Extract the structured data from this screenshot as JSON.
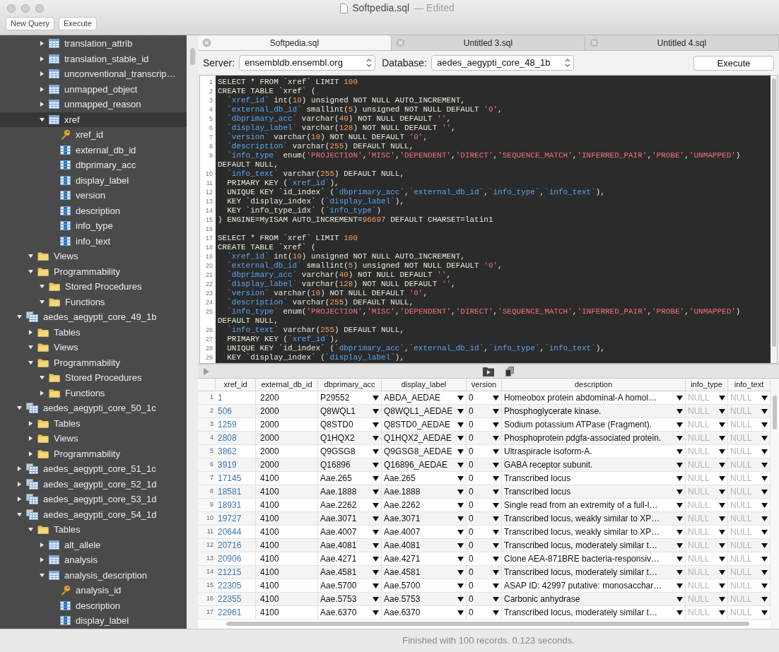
{
  "window": {
    "title": "Softpedia.sql",
    "status": "— Edited"
  },
  "toolbar": {
    "buttons": [
      "New Query",
      "Execute"
    ]
  },
  "sidebar": {
    "partial_tables": [
      {
        "label": "translation_attrib",
        "kind": "table",
        "expanded": false,
        "selected": false
      },
      {
        "label": "translation_stable_id",
        "kind": "table",
        "expanded": false,
        "selected": false
      },
      {
        "label": "unconventional_transcrip…",
        "kind": "table",
        "expanded": false,
        "selected": false
      },
      {
        "label": "unmapped_object",
        "kind": "table",
        "expanded": false,
        "selected": false
      },
      {
        "label": "unmapped_reason",
        "kind": "table",
        "expanded": false,
        "selected": false
      },
      {
        "label": "xref",
        "kind": "table",
        "expanded": true,
        "selected": true,
        "children": [
          {
            "label": "xref_id",
            "kind": "key",
            "selected": false
          },
          {
            "label": "external_db_id",
            "kind": "column",
            "selected": false
          },
          {
            "label": "dbprimary_acc",
            "kind": "column",
            "selected": false
          },
          {
            "label": "display_label",
            "kind": "column",
            "selected": false
          },
          {
            "label": "version",
            "kind": "column",
            "selected": false
          },
          {
            "label": "description",
            "kind": "column",
            "selected": false
          },
          {
            "label": "info_type",
            "kind": "column",
            "selected": false
          },
          {
            "label": "info_text",
            "kind": "column",
            "selected": false
          }
        ]
      }
    ],
    "partial_folders": [
      {
        "label": "Views",
        "kind": "folder",
        "expanded": true,
        "selected": false
      },
      {
        "label": "Programmability",
        "kind": "folder",
        "expanded": true,
        "selected": false,
        "children": [
          {
            "label": "Stored Procedures",
            "kind": "folder",
            "expanded": true,
            "selected": false
          },
          {
            "label": "Functions",
            "kind": "folder",
            "expanded": true,
            "selected": false
          }
        ]
      }
    ],
    "databases": [
      {
        "label": "aedes_aegypti_core_49_1b",
        "kind": "database",
        "expanded": true,
        "selected": false,
        "children": [
          {
            "label": "Tables",
            "kind": "folder",
            "expanded": false,
            "selected": false
          },
          {
            "label": "Views",
            "kind": "folder",
            "expanded": true,
            "selected": false
          },
          {
            "label": "Programmability",
            "kind": "folder",
            "expanded": true,
            "selected": false,
            "children": [
              {
                "label": "Stored Procedures",
                "kind": "folder",
                "expanded": true,
                "selected": false
              },
              {
                "label": "Functions",
                "kind": "folder",
                "expanded": false,
                "selected": false
              }
            ]
          }
        ]
      },
      {
        "label": "aedes_aegypti_core_50_1c",
        "kind": "database",
        "expanded": true,
        "selected": false,
        "children": [
          {
            "label": "Tables",
            "kind": "folder",
            "expanded": false,
            "selected": false
          },
          {
            "label": "Views",
            "kind": "folder",
            "expanded": false,
            "selected": false
          },
          {
            "label": "Programmability",
            "kind": "folder",
            "expanded": false,
            "selected": false
          }
        ]
      },
      {
        "label": "aedes_aegypti_core_51_1c",
        "kind": "database",
        "expanded": false,
        "selected": false
      },
      {
        "label": "aedes_aegypti_core_52_1d",
        "kind": "database",
        "expanded": false,
        "selected": false
      },
      {
        "label": "aedes_aegypti_core_53_1d",
        "kind": "database",
        "expanded": false,
        "selected": false
      },
      {
        "label": "aedes_aegypti_core_54_1d",
        "kind": "database",
        "expanded": true,
        "selected": false,
        "children": [
          {
            "label": "Tables",
            "kind": "folder",
            "expanded": true,
            "selected": false,
            "children": [
              {
                "label": "alt_allele",
                "kind": "table",
                "expanded": false,
                "selected": false
              },
              {
                "label": "analysis",
                "kind": "table",
                "expanded": false,
                "selected": false
              },
              {
                "label": "analysis_description",
                "kind": "table",
                "expanded": true,
                "selected": false,
                "children": [
                  {
                    "label": "analysis_id",
                    "kind": "key",
                    "selected": false
                  },
                  {
                    "label": "description",
                    "kind": "column",
                    "selected": false
                  },
                  {
                    "label": "display_label",
                    "kind": "column",
                    "selected": false
                  }
                ]
              }
            ]
          }
        ]
      }
    ]
  },
  "tabs": [
    {
      "label": "Softpedia.sql",
      "selected": true
    },
    {
      "label": "Untitled 3.sql",
      "selected": false
    },
    {
      "label": "Untitled 4.sql",
      "selected": false
    }
  ],
  "connection": {
    "server_label": "Server:",
    "server": "ensembldb.ensembl.org",
    "database_label": "Database:",
    "database": "aedes_aegypti_core_48_1b",
    "execute": "Execute"
  },
  "editor": {
    "lines": [
      {
        "number": "1",
        "tokens": [
          {
            "kind": "plain",
            "text": "SELECT * FROM `xref` LIMIT "
          },
          {
            "kind": "number",
            "text": "100"
          }
        ]
      },
      {
        "number": "2",
        "tokens": [
          {
            "kind": "plain",
            "text": "CREATE TABLE `xref` ("
          }
        ]
      },
      {
        "number": "3",
        "tokens": [
          {
            "kind": "name",
            "text": "  `xref_id`"
          },
          {
            "kind": "plain",
            "text": " int("
          },
          {
            "kind": "number",
            "text": "10"
          },
          {
            "kind": "plain",
            "text": ") unsigned NOT NULL AUTO_INCREMENT,"
          }
        ]
      },
      {
        "number": "4",
        "tokens": [
          {
            "kind": "name",
            "text": "  `external_db_id`"
          },
          {
            "kind": "plain",
            "text": " smallint("
          },
          {
            "kind": "number",
            "text": "5"
          },
          {
            "kind": "plain",
            "text": ") unsigned NOT NULL DEFAULT "
          },
          {
            "kind": "string",
            "text": "'0'"
          },
          {
            "kind": "plain",
            "text": ","
          }
        ]
      },
      {
        "number": "5",
        "tokens": [
          {
            "kind": "name",
            "text": "  `dbprimary_acc`"
          },
          {
            "kind": "plain",
            "text": " varchar("
          },
          {
            "kind": "number",
            "text": "40"
          },
          {
            "kind": "plain",
            "text": ") NOT NULL DEFAULT "
          },
          {
            "kind": "string",
            "text": "''"
          },
          {
            "kind": "plain",
            "text": ","
          }
        ]
      },
      {
        "number": "6",
        "tokens": [
          {
            "kind": "name",
            "text": "  `display_label`"
          },
          {
            "kind": "plain",
            "text": " varchar("
          },
          {
            "kind": "number",
            "text": "128"
          },
          {
            "kind": "plain",
            "text": ") NOT NULL DEFAULT "
          },
          {
            "kind": "string",
            "text": "''"
          },
          {
            "kind": "plain",
            "text": ","
          }
        ]
      },
      {
        "number": "7",
        "tokens": [
          {
            "kind": "name",
            "text": "  `version`"
          },
          {
            "kind": "plain",
            "text": " varchar("
          },
          {
            "kind": "number",
            "text": "10"
          },
          {
            "kind": "plain",
            "text": ") NOT NULL DEFAULT "
          },
          {
            "kind": "string",
            "text": "'0'"
          },
          {
            "kind": "plain",
            "text": ","
          }
        ]
      },
      {
        "number": "8",
        "tokens": [
          {
            "kind": "name",
            "text": "  `description`"
          },
          {
            "kind": "plain",
            "text": " varchar("
          },
          {
            "kind": "number",
            "text": "255"
          },
          {
            "kind": "plain",
            "text": ") DEFAULT NULL,"
          }
        ]
      },
      {
        "number": "9",
        "tokens": [
          {
            "kind": "name",
            "text": "  `info_type`"
          },
          {
            "kind": "plain",
            "text": " enum("
          },
          {
            "kind": "string",
            "text": "'PROJECTION'"
          },
          {
            "kind": "plain",
            "text": ","
          },
          {
            "kind": "string",
            "text": "'MISC'"
          },
          {
            "kind": "plain",
            "text": ","
          },
          {
            "kind": "string",
            "text": "'DEPENDENT'"
          },
          {
            "kind": "plain",
            "text": ","
          },
          {
            "kind": "string",
            "text": "'DIRECT'"
          },
          {
            "kind": "plain",
            "text": ","
          },
          {
            "kind": "string",
            "text": "'SEQUENCE_MATCH'"
          },
          {
            "kind": "plain",
            "text": ","
          },
          {
            "kind": "string",
            "text": "'INFERRED_PAIR'"
          },
          {
            "kind": "plain",
            "text": ","
          },
          {
            "kind": "string",
            "text": "'PROBE'"
          },
          {
            "kind": "plain",
            "text": ","
          },
          {
            "kind": "string",
            "text": "'UNMAPPED'"
          },
          {
            "kind": "plain",
            "text": ")"
          }
        ]
      },
      {
        "tokens": [
          {
            "kind": "plain",
            "text": "DEFAULT NULL,"
          }
        ]
      },
      {
        "number": "10",
        "tokens": [
          {
            "kind": "name",
            "text": "  `info_text`"
          },
          {
            "kind": "plain",
            "text": " varchar("
          },
          {
            "kind": "number",
            "text": "255"
          },
          {
            "kind": "plain",
            "text": ") DEFAULT NULL,"
          }
        ]
      },
      {
        "number": "11",
        "tokens": [
          {
            "kind": "plain",
            "text": "  PRIMARY KEY ("
          },
          {
            "kind": "name",
            "text": "`xref_id`"
          },
          {
            "kind": "plain",
            "text": "),"
          }
        ]
      },
      {
        "number": "12",
        "tokens": [
          {
            "kind": "plain",
            "text": "  UNIQUE KEY `id_index` ("
          },
          {
            "kind": "name",
            "text": "`dbprimary_acc`"
          },
          {
            "kind": "plain",
            "text": ","
          },
          {
            "kind": "name",
            "text": "`external_db_id`"
          },
          {
            "kind": "plain",
            "text": ","
          },
          {
            "kind": "name",
            "text": "`info_type`"
          },
          {
            "kind": "plain",
            "text": ","
          },
          {
            "kind": "name",
            "text": "`info_text`"
          },
          {
            "kind": "plain",
            "text": "),"
          }
        ]
      },
      {
        "number": "13",
        "tokens": [
          {
            "kind": "plain",
            "text": "  KEY `display_index` ("
          },
          {
            "kind": "name",
            "text": "`display_label`"
          },
          {
            "kind": "plain",
            "text": "),"
          }
        ]
      },
      {
        "number": "14",
        "tokens": [
          {
            "kind": "plain",
            "text": "  KEY `info_type_idx` ("
          },
          {
            "kind": "name",
            "text": "`info_type`"
          },
          {
            "kind": "plain",
            "text": ")"
          }
        ]
      },
      {
        "number": "15",
        "tokens": [
          {
            "kind": "plain",
            "text": ") ENGINE=MyISAM AUTO_INCREMENT="
          },
          {
            "kind": "number",
            "text": "96697"
          },
          {
            "kind": "plain",
            "text": " DEFAULT CHARSET=latin1"
          }
        ]
      },
      {
        "number": "16"
      },
      {
        "number": "17",
        "tokens": [
          {
            "kind": "plain",
            "text": "SELECT * FROM `xref` LIMIT "
          },
          {
            "kind": "number",
            "text": "100"
          }
        ]
      },
      {
        "number": "18",
        "tokens": [
          {
            "kind": "plain",
            "text": "CREATE TABLE `xref` ("
          }
        ]
      },
      {
        "number": "19",
        "tokens": [
          {
            "kind": "name",
            "text": "  `xref_id`"
          },
          {
            "kind": "plain",
            "text": " int("
          },
          {
            "kind": "number",
            "text": "10"
          },
          {
            "kind": "plain",
            "text": ") unsigned NOT NULL AUTO_INCREMENT,"
          }
        ]
      },
      {
        "number": "20",
        "tokens": [
          {
            "kind": "name",
            "text": "  `external_db_id`"
          },
          {
            "kind": "plain",
            "text": " smallint("
          },
          {
            "kind": "number",
            "text": "5"
          },
          {
            "kind": "plain",
            "text": ") unsigned NOT NULL DEFAULT "
          },
          {
            "kind": "string",
            "text": "'0'"
          },
          {
            "kind": "plain",
            "text": ","
          }
        ]
      },
      {
        "number": "21",
        "tokens": [
          {
            "kind": "name",
            "text": "  `dbprimary_acc`"
          },
          {
            "kind": "plain",
            "text": " varchar("
          },
          {
            "kind": "number",
            "text": "40"
          },
          {
            "kind": "plain",
            "text": ") NOT NULL DEFAULT "
          },
          {
            "kind": "string",
            "text": "''"
          },
          {
            "kind": "plain",
            "text": ","
          }
        ]
      },
      {
        "number": "22",
        "tokens": [
          {
            "kind": "name",
            "text": "  `display_label`"
          },
          {
            "kind": "plain",
            "text": " varchar("
          },
          {
            "kind": "number",
            "text": "128"
          },
          {
            "kind": "plain",
            "text": ") NOT NULL DEFAULT "
          },
          {
            "kind": "string",
            "text": "''"
          },
          {
            "kind": "plain",
            "text": ","
          }
        ]
      },
      {
        "number": "23",
        "tokens": [
          {
            "kind": "name",
            "text": "  `version`"
          },
          {
            "kind": "plain",
            "text": " varchar("
          },
          {
            "kind": "number",
            "text": "10"
          },
          {
            "kind": "plain",
            "text": ") NOT NULL DEFAULT "
          },
          {
            "kind": "string",
            "text": "'0'"
          },
          {
            "kind": "plain",
            "text": ","
          }
        ]
      },
      {
        "number": "24",
        "tokens": [
          {
            "kind": "name",
            "text": "  `description`"
          },
          {
            "kind": "plain",
            "text": " varchar("
          },
          {
            "kind": "number",
            "text": "255"
          },
          {
            "kind": "plain",
            "text": ") DEFAULT NULL,"
          }
        ]
      },
      {
        "number": "25",
        "tokens": [
          {
            "kind": "name",
            "text": "  `info_type`"
          },
          {
            "kind": "plain",
            "text": " enum("
          },
          {
            "kind": "string",
            "text": "'PROJECTION'"
          },
          {
            "kind": "plain",
            "text": ","
          },
          {
            "kind": "string",
            "text": "'MISC'"
          },
          {
            "kind": "plain",
            "text": ","
          },
          {
            "kind": "string",
            "text": "'DEPENDENT'"
          },
          {
            "kind": "plain",
            "text": ","
          },
          {
            "kind": "string",
            "text": "'DIRECT'"
          },
          {
            "kind": "plain",
            "text": ","
          },
          {
            "kind": "string",
            "text": "'SEQUENCE_MATCH'"
          },
          {
            "kind": "plain",
            "text": ","
          },
          {
            "kind": "string",
            "text": "'INFERRED_PAIR'"
          },
          {
            "kind": "plain",
            "text": ","
          },
          {
            "kind": "string",
            "text": "'PROBE'"
          },
          {
            "kind": "plain",
            "text": ","
          },
          {
            "kind": "string",
            "text": "'UNMAPPED'"
          },
          {
            "kind": "plain",
            "text": ")"
          }
        ]
      },
      {
        "tokens": [
          {
            "kind": "plain",
            "text": "DEFAULT NULL,"
          }
        ]
      },
      {
        "number": "26",
        "tokens": [
          {
            "kind": "name",
            "text": "  `info_text`"
          },
          {
            "kind": "plain",
            "text": " varchar("
          },
          {
            "kind": "number",
            "text": "255"
          },
          {
            "kind": "plain",
            "text": ") DEFAULT NULL,"
          }
        ]
      },
      {
        "number": "27",
        "tokens": [
          {
            "kind": "plain",
            "text": "  PRIMARY KEY ("
          },
          {
            "kind": "name",
            "text": "`xref_id`"
          },
          {
            "kind": "plain",
            "text": "),"
          }
        ]
      },
      {
        "number": "28",
        "tokens": [
          {
            "kind": "plain",
            "text": "  UNIQUE KEY `id_index` ("
          },
          {
            "kind": "name",
            "text": "`dbprimary_acc`"
          },
          {
            "kind": "plain",
            "text": ","
          },
          {
            "kind": "name",
            "text": "`external_db_id`"
          },
          {
            "kind": "plain",
            "text": ","
          },
          {
            "kind": "name",
            "text": "`info_type`"
          },
          {
            "kind": "plain",
            "text": ","
          },
          {
            "kind": "name",
            "text": "`info_text`"
          },
          {
            "kind": "plain",
            "text": "),"
          }
        ]
      },
      {
        "number": "29",
        "tokens": [
          {
            "kind": "plain",
            "text": "  KEY `display_index` ("
          },
          {
            "kind": "name",
            "text": "`display_label`"
          },
          {
            "kind": "plain",
            "text": "),"
          }
        ]
      }
    ]
  },
  "results": {
    "columns": [
      {
        "label": "xref_id",
        "kind": "link"
      },
      {
        "label": "external_db_id",
        "kind": "text"
      },
      {
        "label": "dbprimary_acc",
        "kind": "choice"
      },
      {
        "label": "display_label",
        "kind": "choice"
      },
      {
        "label": "version",
        "kind": "choice"
      },
      {
        "label": "description",
        "kind": "choice"
      },
      {
        "label": "info_type",
        "kind": "null-choice"
      },
      {
        "label": "info_text",
        "kind": "null-choice"
      }
    ],
    "rows": [
      {
        "number": "1",
        "cells": [
          "1",
          "2200",
          "P29552",
          "ABDA_AEDAE",
          "0",
          "Homeobox protein abdominal-A homol…",
          "NULL",
          "NULL"
        ]
      },
      {
        "number": "2",
        "cells": [
          "506",
          "2000",
          "Q8WQL1",
          "Q8WQL1_AEDAE",
          "0",
          "Phosphoglycerate kinase.",
          "NULL",
          "NULL"
        ]
      },
      {
        "number": "3",
        "cells": [
          "1259",
          "2000",
          "Q8STD0",
          "Q8STD0_AEDAE",
          "0",
          "Sodium potassium ATPase (Fragment).",
          "NULL",
          "NULL"
        ]
      },
      {
        "number": "4",
        "cells": [
          "2808",
          "2000",
          "Q1HQX2",
          "Q1HQX2_AEDAE",
          "0",
          "Phosphoprotein pdgfa-associated protein.",
          "NULL",
          "NULL"
        ]
      },
      {
        "number": "5",
        "cells": [
          "3862",
          "2000",
          "Q9GSG8",
          "Q9GSG8_AEDAE",
          "0",
          "Ultraspiracle isoform-A.",
          "NULL",
          "NULL"
        ]
      },
      {
        "number": "6",
        "cells": [
          "3919",
          "2000",
          "Q16896",
          "Q16896_AEDAE",
          "0",
          "GABA receptor subunit.",
          "NULL",
          "NULL"
        ]
      },
      {
        "number": "7",
        "cells": [
          "17145",
          "4100",
          "Aae.265",
          "Aae.265",
          "0",
          "Transcribed locus",
          "NULL",
          "NULL"
        ]
      },
      {
        "number": "8",
        "cells": [
          "18581",
          "4100",
          "Aae.1888",
          "Aae.1888",
          "0",
          "Transcribed locus",
          "NULL",
          "NULL"
        ]
      },
      {
        "number": "9",
        "cells": [
          "18931",
          "4100",
          "Aae.2262",
          "Aae.2262",
          "0",
          "Single read from an extremity of a full-l…",
          "NULL",
          "NULL"
        ]
      },
      {
        "number": "10",
        "cells": [
          "19727",
          "4100",
          "Aae.3071",
          "Aae.3071",
          "0",
          "Transcribed locus, weakly similar to XP…",
          "NULL",
          "NULL"
        ]
      },
      {
        "number": "11",
        "cells": [
          "20644",
          "4100",
          "Aae.4007",
          "Aae.4007",
          "0",
          "Transcribed locus, weakly similar to XP…",
          "NULL",
          "NULL"
        ]
      },
      {
        "number": "12",
        "cells": [
          "20716",
          "4100",
          "Aae.4081",
          "Aae.4081",
          "0",
          "Transcribed locus, moderately similar t…",
          "NULL",
          "NULL"
        ]
      },
      {
        "number": "13",
        "cells": [
          "20906",
          "4100",
          "Aae.4271",
          "Aae.4271",
          "0",
          "Clone AEA-871BRE bacteria-responsiv…",
          "NULL",
          "NULL"
        ]
      },
      {
        "number": "14",
        "cells": [
          "21215",
          "4100",
          "Aae.4581",
          "Aae.4581",
          "0",
          "Transcribed locus, moderately similar t…",
          "NULL",
          "NULL"
        ]
      },
      {
        "number": "15",
        "cells": [
          "22305",
          "4100",
          "Aae.5700",
          "Aae.5700",
          "0",
          "ASAP ID: 42997 putative: monosacchar…",
          "NULL",
          "NULL"
        ]
      },
      {
        "number": "16",
        "cells": [
          "22355",
          "4100",
          "Aae.5753",
          "Aae.5753",
          "0",
          "Carbonic anhydrase",
          "NULL",
          "NULL"
        ]
      },
      {
        "number": "17",
        "cells": [
          "22961",
          "4100",
          "Aae.6370",
          "Aae.6370",
          "0",
          "Transcribed locus, moderately similar t…",
          "NULL",
          "NULL"
        ]
      }
    ]
  },
  "status_bar": {
    "text": "Finished with 100 records. 0.123 seconds."
  }
}
